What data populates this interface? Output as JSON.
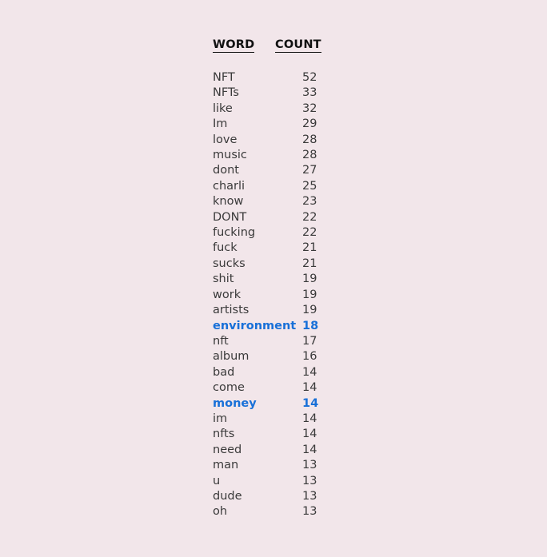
{
  "page": {
    "background_color": "#f2e6ea",
    "text_color": "#3a3a3a",
    "header_color": "#111111",
    "highlight_color": "#1870d8"
  },
  "table": {
    "headers": {
      "word": "WORD",
      "count": "COUNT"
    },
    "rows": [
      {
        "word": "NFT",
        "count": "52",
        "highlighted": false
      },
      {
        "word": "NFTs",
        "count": "33",
        "highlighted": false
      },
      {
        "word": "like",
        "count": "32",
        "highlighted": false
      },
      {
        "word": "Im",
        "count": "29",
        "highlighted": false
      },
      {
        "word": "love",
        "count": "28",
        "highlighted": false
      },
      {
        "word": "music",
        "count": "28",
        "highlighted": false
      },
      {
        "word": "dont",
        "count": "27",
        "highlighted": false
      },
      {
        "word": "charli",
        "count": "25",
        "highlighted": false
      },
      {
        "word": "know",
        "count": "23",
        "highlighted": false
      },
      {
        "word": "DONT",
        "count": "22",
        "highlighted": false
      },
      {
        "word": "fucking",
        "count": "22",
        "highlighted": false
      },
      {
        "word": "fuck",
        "count": "21",
        "highlighted": false
      },
      {
        "word": "sucks",
        "count": "21",
        "highlighted": false
      },
      {
        "word": "shit",
        "count": "19",
        "highlighted": false
      },
      {
        "word": "work",
        "count": "19",
        "highlighted": false
      },
      {
        "word": "artists",
        "count": "19",
        "highlighted": false
      },
      {
        "word": "environment",
        "count": "18",
        "highlighted": true
      },
      {
        "word": "nft",
        "count": "17",
        "highlighted": false
      },
      {
        "word": "album",
        "count": "16",
        "highlighted": false
      },
      {
        "word": "bad",
        "count": "14",
        "highlighted": false
      },
      {
        "word": "come",
        "count": "14",
        "highlighted": false
      },
      {
        "word": "money",
        "count": "14",
        "highlighted": true
      },
      {
        "word": "im",
        "count": "14",
        "highlighted": false
      },
      {
        "word": "nfts",
        "count": "14",
        "highlighted": false
      },
      {
        "word": "need",
        "count": "14",
        "highlighted": false
      },
      {
        "word": "man",
        "count": "13",
        "highlighted": false
      },
      {
        "word": "u",
        "count": "13",
        "highlighted": false
      },
      {
        "word": "dude",
        "count": "13",
        "highlighted": false
      },
      {
        "word": "oh",
        "count": "13",
        "highlighted": false
      }
    ]
  },
  "chart_data": {
    "type": "table",
    "title": "",
    "columns": [
      "WORD",
      "COUNT"
    ],
    "categories": [
      "NFT",
      "NFTs",
      "like",
      "Im",
      "love",
      "music",
      "dont",
      "charli",
      "know",
      "DONT",
      "fucking",
      "fuck",
      "sucks",
      "shit",
      "work",
      "artists",
      "environment",
      "nft",
      "album",
      "bad",
      "come",
      "money",
      "im",
      "nfts",
      "need",
      "man",
      "u",
      "dude",
      "oh"
    ],
    "values": [
      52,
      33,
      32,
      29,
      28,
      28,
      27,
      25,
      23,
      22,
      22,
      21,
      21,
      19,
      19,
      19,
      18,
      17,
      16,
      14,
      14,
      14,
      14,
      14,
      14,
      13,
      13,
      13,
      13
    ],
    "xlabel": "WORD",
    "ylabel": "COUNT",
    "highlighted_categories": [
      "environment",
      "money"
    ],
    "legend": []
  }
}
